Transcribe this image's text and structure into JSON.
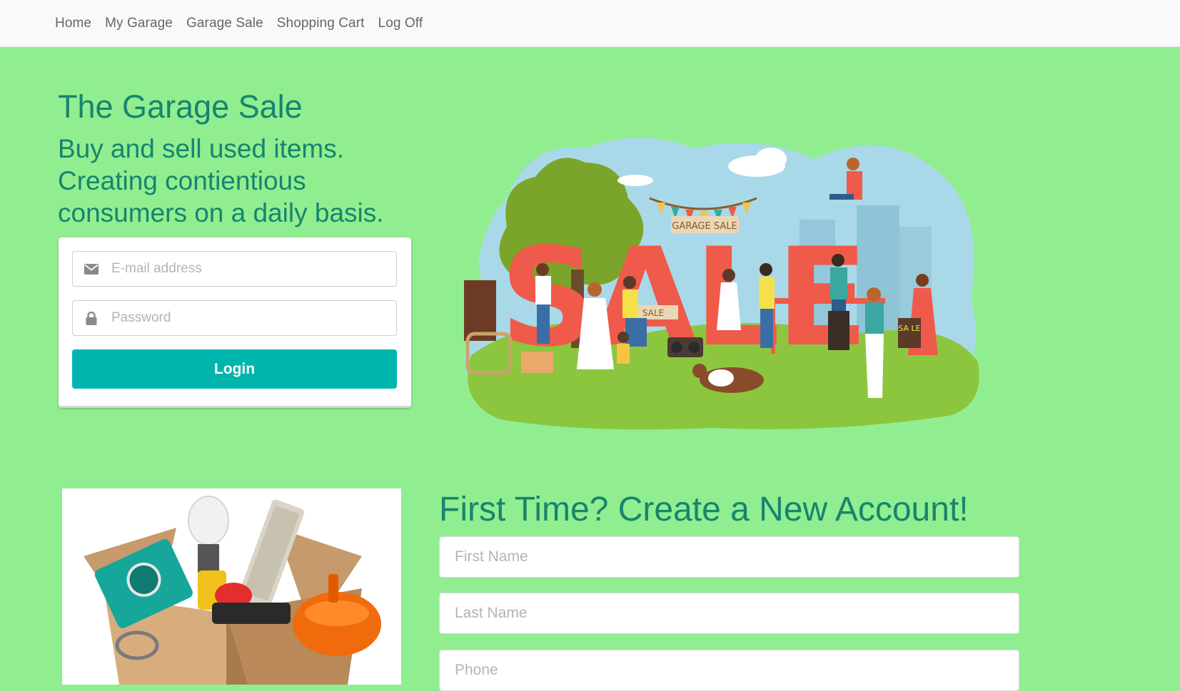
{
  "nav": {
    "items": [
      {
        "label": "Home"
      },
      {
        "label": "My Garage"
      },
      {
        "label": "Garage Sale"
      },
      {
        "label": "Shopping Cart"
      },
      {
        "label": "Log Off"
      }
    ]
  },
  "hero": {
    "title": "The Garage Sale",
    "subtitle": "Buy and sell used items. Creating contientious consumers on a daily basis."
  },
  "login": {
    "email_placeholder": "E-mail address",
    "email_icon": "envelope-icon",
    "password_placeholder": "Password",
    "password_icon": "lock-icon",
    "button_label": "Login",
    "button_color": "#00b5ad"
  },
  "illustration": {
    "sign_text": "SALE",
    "banner_text": "GARAGE SALE",
    "table_sign": "SALE",
    "held_sign": "SA LE"
  },
  "signup": {
    "title": "First Time? Create a New Account!",
    "first_name_placeholder": "First Name",
    "last_name_placeholder": "Last Name",
    "phone_placeholder": "Phone"
  },
  "colors": {
    "page_background": "#90ee90",
    "heading": "#17846e",
    "navbar": "#f8f9fa"
  }
}
